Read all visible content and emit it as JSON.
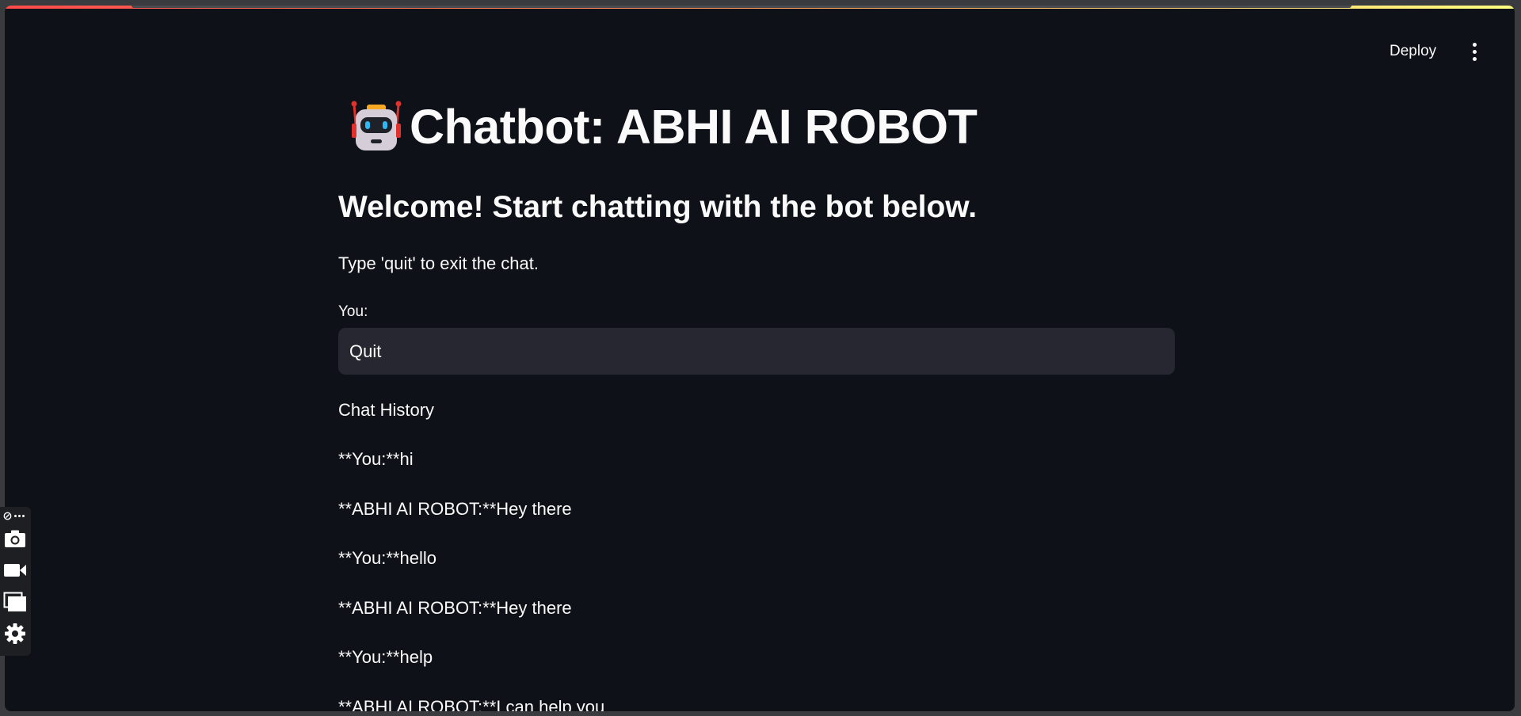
{
  "header": {
    "deploy_label": "Deploy"
  },
  "main": {
    "title": "Chatbot: ABHI AI ROBOT",
    "title_icon": "robot-icon",
    "subheader": "Welcome! Start chatting with the bot below.",
    "instructions": "Type 'quit' to exit the chat.",
    "input_label": "You:",
    "input_value": "Quit",
    "history_title": "Chat History",
    "history": [
      "**You:**hi",
      "**ABHI AI ROBOT:**Hey there",
      "**You:**hello",
      "**ABHI AI ROBOT:**Hey there",
      "**You:**help",
      "**ABHI AI ROBOT:**I can help you"
    ]
  },
  "toolbar": {
    "items": [
      "link-icon",
      "more-icon",
      "camera-icon",
      "video-icon",
      "window-icon",
      "gear-icon"
    ]
  },
  "colors": {
    "background": "#0e1117",
    "input_background": "#262730",
    "text": "#fafafa",
    "accent_start": "#ff4b4b",
    "accent_end": "#fffd80"
  }
}
